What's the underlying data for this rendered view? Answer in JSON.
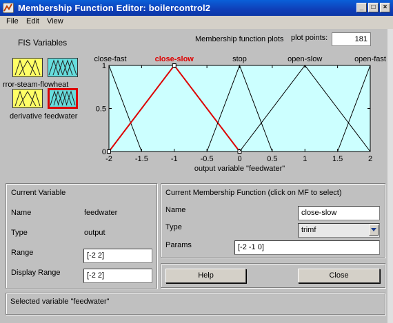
{
  "window": {
    "title": "Membership Function Editor: boilercontrol2"
  },
  "menu": [
    "File",
    "Edit",
    "View"
  ],
  "fis_panel": {
    "title": "FIS Variables",
    "labels": [
      "rror-steam-flowheat",
      "derivative feedwater"
    ]
  },
  "plot_header": {
    "title": "Membership function plots",
    "plot_points_label": "plot points:",
    "plot_points_value": "181"
  },
  "chart_data": {
    "type": "line",
    "xlabel": "output variable \"feedwater\"",
    "xlim": [
      -2,
      2
    ],
    "ylim": [
      0,
      1
    ],
    "xticks": [
      "-2",
      "-1.5",
      "-1",
      "-0.5",
      "0",
      "0.5",
      "1",
      "1.5",
      "2"
    ],
    "yticks": [
      "0",
      "0.5",
      "1"
    ],
    "selected": "close-slow",
    "line_color": "#000000",
    "selected_color": "#dd0000",
    "background": "#ccffff",
    "series": [
      {
        "name": "close-fast",
        "x": [
          -2,
          -2,
          -1.5
        ],
        "y": [
          0,
          1,
          0
        ]
      },
      {
        "name": "close-slow",
        "x": [
          -2,
          -1,
          0
        ],
        "y": [
          0,
          1,
          0
        ]
      },
      {
        "name": "stop",
        "x": [
          -0.5,
          0,
          0.5
        ],
        "y": [
          0,
          1,
          0
        ]
      },
      {
        "name": "open-slow",
        "x": [
          0,
          1,
          2
        ],
        "y": [
          0,
          1,
          0
        ]
      },
      {
        "name": "open-fast",
        "x": [
          1.5,
          2,
          2
        ],
        "y": [
          0,
          1,
          0
        ]
      }
    ]
  },
  "current_variable": {
    "header": "Current Variable",
    "name_label": "Name",
    "name_value": "feedwater",
    "type_label": "Type",
    "type_value": "output",
    "range_label": "Range",
    "range_value": "[-2 2]",
    "display_range_label": "Display Range",
    "display_range_value": "[-2 2]"
  },
  "current_mf": {
    "header": "Current Membership Function (click on MF to select)",
    "name_label": "Name",
    "name_value": "close-slow",
    "type_label": "Type",
    "type_value": "trimf",
    "params_label": "Params",
    "params_value": "[-2 -1 0]"
  },
  "buttons": {
    "help": "Help",
    "close": "Close"
  },
  "status": "Selected variable \"feedwater\""
}
